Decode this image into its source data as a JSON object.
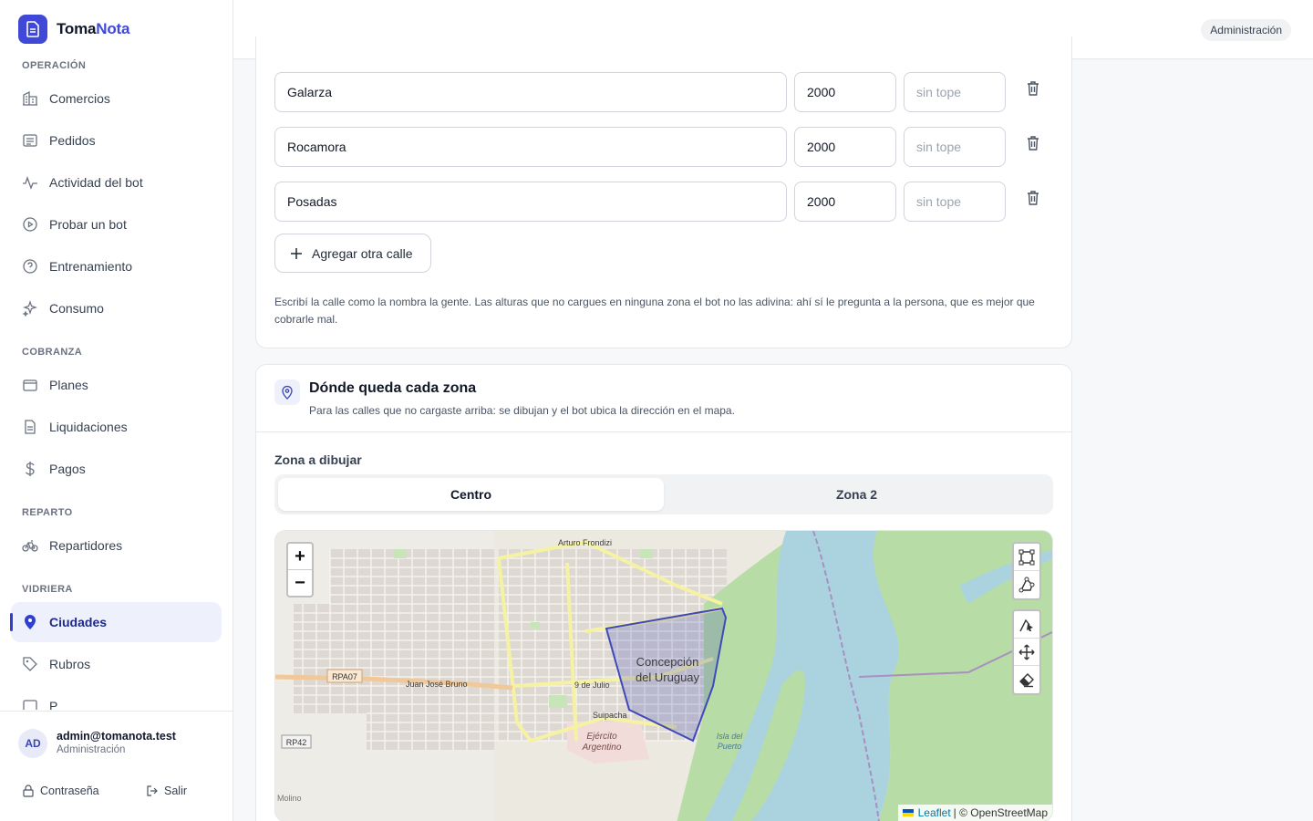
{
  "app": {
    "name_prefix": "Toma",
    "name_accent": "Nota"
  },
  "header": {
    "role_badge": "Administración"
  },
  "sidebar": {
    "sections": [
      {
        "title": "OPERACIÓN",
        "items": [
          {
            "label": "Comercios",
            "icon": "building-icon"
          },
          {
            "label": "Pedidos",
            "icon": "list-icon"
          },
          {
            "label": "Actividad del bot",
            "icon": "activity-icon"
          },
          {
            "label": "Probar un bot",
            "icon": "play-circle-icon"
          },
          {
            "label": "Entrenamiento",
            "icon": "help-circle-icon"
          },
          {
            "label": "Consumo",
            "icon": "sparkles-icon"
          }
        ]
      },
      {
        "title": "COBRANZA",
        "items": [
          {
            "label": "Planes",
            "icon": "wallet-icon"
          },
          {
            "label": "Liquidaciones",
            "icon": "file-text-icon"
          },
          {
            "label": "Pagos",
            "icon": "dollar-icon"
          }
        ]
      },
      {
        "title": "REPARTO",
        "items": [
          {
            "label": "Repartidores",
            "icon": "bike-icon"
          }
        ]
      },
      {
        "title": "VIDRIERA",
        "items": [
          {
            "label": "Ciudades",
            "icon": "map-pin-icon",
            "active": true
          },
          {
            "label": "Rubros",
            "icon": "tag-icon"
          },
          {
            "label": "P",
            "icon": "image-icon"
          }
        ]
      }
    ],
    "user": {
      "initials": "AD",
      "email": "admin@tomanota.test",
      "role": "Administración",
      "password_link": "Contraseña",
      "logout_link": "Salir"
    }
  },
  "streets": {
    "rows": [
      {
        "name": "Galarza",
        "from": "2000",
        "to_placeholder": "sin tope"
      },
      {
        "name": "Rocamora",
        "from": "2000",
        "to_placeholder": "sin tope"
      },
      {
        "name": "Posadas",
        "from": "2000",
        "to_placeholder": "sin tope"
      }
    ],
    "add_label": "Agregar otra calle",
    "help": "Escribí la calle como la nombra la gente. Las alturas que no cargues en ninguna zona el bot no las adivina: ahí sí le pregunta a la persona, que es mejor que cobrarle mal."
  },
  "zones": {
    "title": "Dónde queda cada zona",
    "subtitle": "Para las calles que no cargaste arriba: se dibujan y el bot ubica la dirección en el mapa.",
    "draw_label": "Zona a dibujar",
    "tabs": [
      {
        "label": "Centro",
        "active": true
      },
      {
        "label": "Zona 2",
        "active": false
      }
    ]
  },
  "map": {
    "zoom_in": "+",
    "zoom_out": "−",
    "city_label_line1": "Concepción",
    "city_label_line2": "del Uruguay",
    "labels": {
      "army": "Ejército",
      "army2": "Argentino",
      "rpa07": "RPA07",
      "rp42": "RP42",
      "juan_jose_bruno": "Juan José Bruno",
      "nueve_julio": "9 de Julio",
      "suipacha": "Suipacha",
      "arturo_frondizi": "Arturo Frondizi",
      "isla_puerto": "Isla del",
      "isla_puerto2": "Puerto",
      "molino": "Molino"
    },
    "attribution_leaflet": "Leaflet",
    "attribution_osm": "| © OpenStreetMap",
    "colors": {
      "river": "#aad3df",
      "park": "#b7dca5",
      "polygon": "#3f4ab8"
    }
  }
}
